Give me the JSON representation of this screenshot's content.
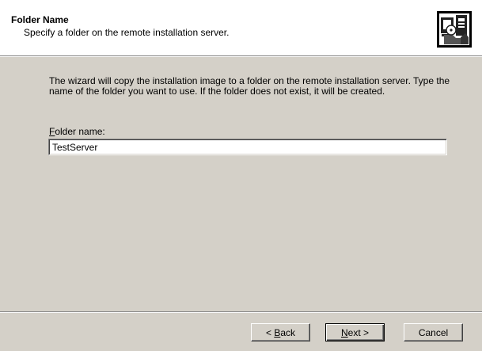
{
  "header": {
    "title": "Folder Name",
    "subtitle": "Specify a folder on the remote installation server.",
    "graphic_icon": "computer-folder-icon"
  },
  "body": {
    "intro_text": "The wizard will copy the installation image to a folder on the remote installation server. Type the name of the folder you want to use. If the folder does not exist, it will be created.",
    "field_label_accel": "F",
    "field_label_rest": "older name:",
    "folder_name_value": "TestServer"
  },
  "buttons": {
    "back_prefix": "< ",
    "back_accel": "B",
    "back_rest": "ack",
    "next_accel": "N",
    "next_rest": "ext >",
    "cancel_label": "Cancel"
  },
  "colors": {
    "dialog_face": "#d4d0c8",
    "header_background": "#ffffff"
  }
}
